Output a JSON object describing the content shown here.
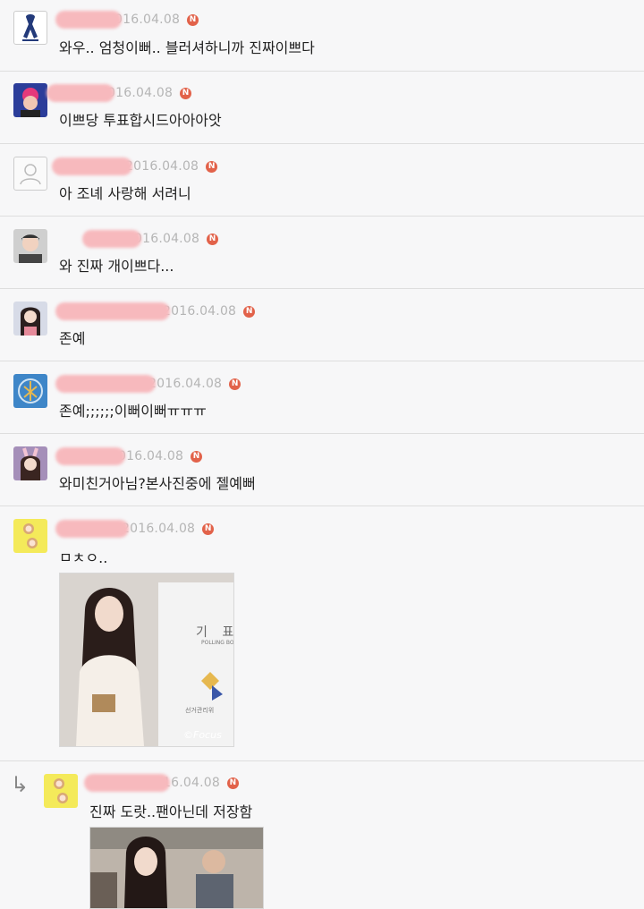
{
  "comments": [
    {
      "date": "016.04.08",
      "text": "와우.. 엄청이뻐.. 블러셔하니까 진짜이쁘다"
    },
    {
      "date": "016.04.08",
      "text": "이쁘당 투표합시드아아아앗"
    },
    {
      "date": "2016.04.08",
      "text": "아 조녜 사랑해 서려니"
    },
    {
      "date": "016.04.08",
      "text": "와 진짜 개이쁘다..."
    },
    {
      "date": "2016.04.08",
      "text": "존예"
    },
    {
      "date": "2016.04.08",
      "text": "존예;;;;;;이뻐이뻐ㅠㅠㅠ"
    },
    {
      "date": "016.04.08",
      "text": "와미친거아님?본사진중에 젤예뻐"
    },
    {
      "date": "2016.04.08",
      "text": "ㅁㅊㅇ.."
    },
    {
      "date": "16.04.08",
      "text": "진짜 도랏..팬아닌데 저장함"
    }
  ],
  "badge": "N",
  "photo1": {
    "sign_main": "기 표",
    "sign_sub": "POLLING BO",
    "sign_org": "선거관리위",
    "watermark": "©Focus"
  },
  "reply_arrow": "↳"
}
